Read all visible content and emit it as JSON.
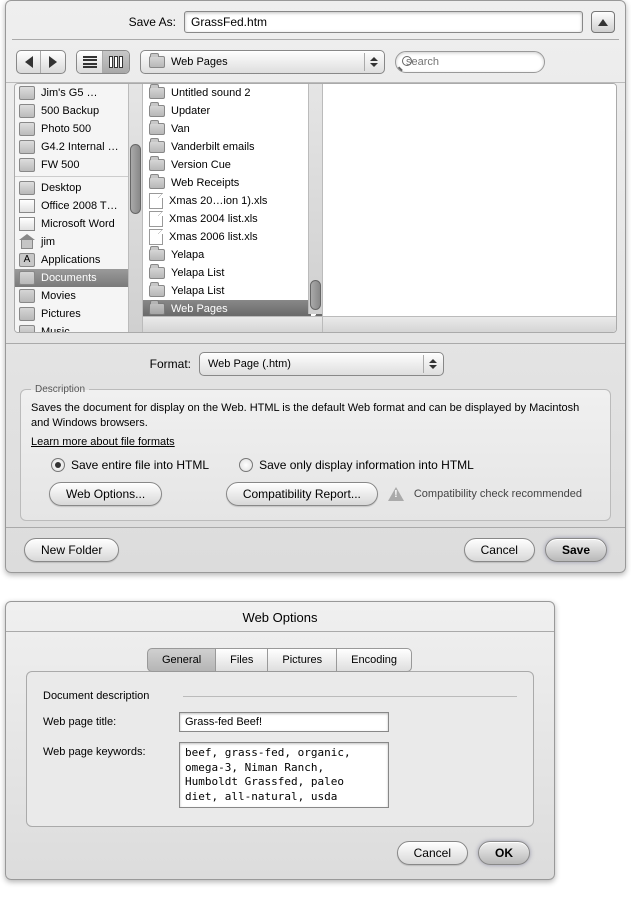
{
  "save_dialog": {
    "save_as_label": "Save As:",
    "filename": "GrassFed.htm",
    "location_popup": "Web Pages",
    "search_placeholder": "search",
    "sidebar": {
      "devices": [
        {
          "label": "Jim's G5 …",
          "icon": "disk"
        },
        {
          "label": "500 Backup",
          "icon": "disk"
        },
        {
          "label": "Photo 500",
          "icon": "disk"
        },
        {
          "label": "G4.2 Internal …",
          "icon": "disk"
        },
        {
          "label": "FW 500",
          "icon": "disk"
        }
      ],
      "places": [
        {
          "label": "Desktop",
          "icon": "desk"
        },
        {
          "label": "Office 2008 T…",
          "icon": "doc"
        },
        {
          "label": "Microsoft Word",
          "icon": "doc"
        },
        {
          "label": "jim",
          "icon": "house"
        },
        {
          "label": "Applications",
          "icon": "app"
        },
        {
          "label": "Documents",
          "icon": "folder",
          "selected": true
        },
        {
          "label": "Movies",
          "icon": "folder"
        },
        {
          "label": "Pictures",
          "icon": "folder"
        },
        {
          "label": "Music",
          "icon": "folder"
        }
      ]
    },
    "column_items": [
      {
        "label": "Untitled sound 2",
        "type": "folder",
        "arrow": true
      },
      {
        "label": "Updater",
        "type": "folder",
        "arrow": true
      },
      {
        "label": "Van",
        "type": "folder",
        "arrow": true
      },
      {
        "label": "Vanderbilt emails",
        "type": "folder",
        "arrow": true
      },
      {
        "label": "Version Cue",
        "type": "folder",
        "arrow": true
      },
      {
        "label": "Web Receipts",
        "type": "folder",
        "arrow": true
      },
      {
        "label": "Xmas 20…ion 1).xls",
        "type": "file"
      },
      {
        "label": "Xmas 2004 list.xls",
        "type": "file"
      },
      {
        "label": "Xmas 2006 list.xls",
        "type": "file"
      },
      {
        "label": "Yelapa",
        "type": "folder",
        "arrow": true
      },
      {
        "label": "Yelapa List",
        "type": "folder",
        "arrow": true
      },
      {
        "label": "Yelapa List",
        "type": "folder",
        "arrow": true
      },
      {
        "label": "Web Pages",
        "type": "folder",
        "arrow": true,
        "selected": true
      }
    ],
    "format_label": "Format:",
    "format_value": "Web Page (.htm)",
    "description": {
      "heading": "Description",
      "text": "Saves the document for display on the Web. HTML is the default Web format and can be displayed by Macintosh and Windows browsers.",
      "link": "Learn more about file formats"
    },
    "radios": {
      "entire": "Save entire file into HTML",
      "display": "Save only display information into HTML"
    },
    "buttons": {
      "web_options": "Web Options...",
      "compat_report": "Compatibility Report...",
      "compat_text": "Compatibility check recommended",
      "new_folder": "New Folder",
      "cancel": "Cancel",
      "save": "Save"
    }
  },
  "web_options": {
    "title": "Web Options",
    "tabs": [
      "General",
      "Files",
      "Pictures",
      "Encoding"
    ],
    "active_tab": 0,
    "fieldset": "Document description",
    "title_label": "Web page title:",
    "title_value": "Grass-fed Beef!",
    "keywords_label": "Web page keywords:",
    "keywords_value": "beef, grass-fed, organic, omega-3, Niman Ranch, Humboldt Grassfed, paleo diet, all-natural, usda prime, ",
    "cancel": "Cancel",
    "ok": "OK"
  }
}
